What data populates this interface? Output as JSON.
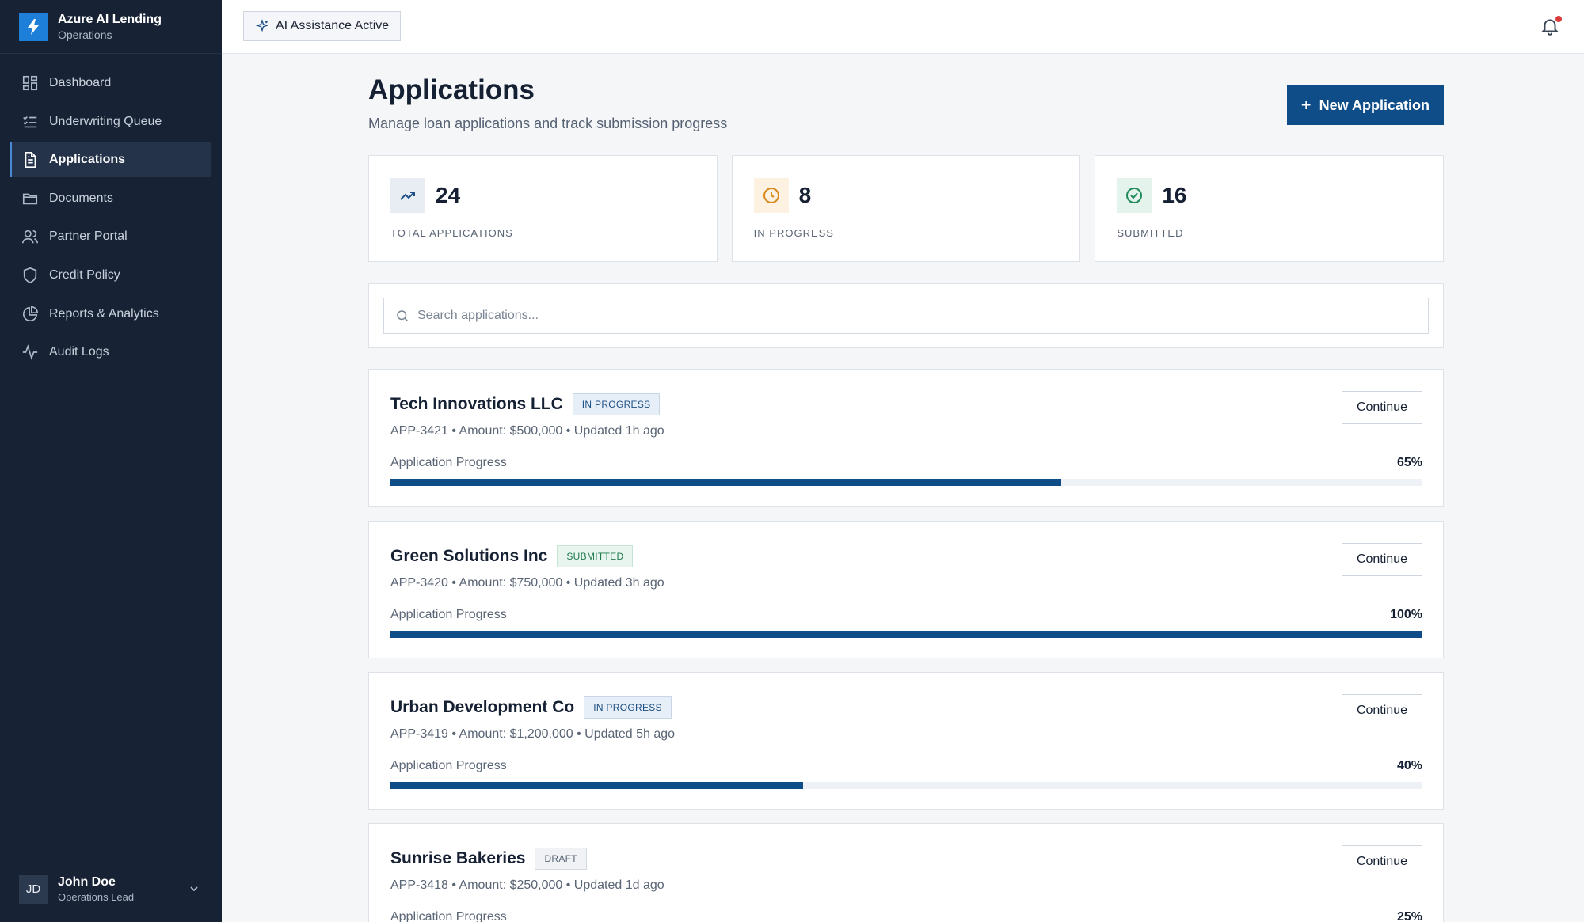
{
  "brand": {
    "title": "Azure AI Lending",
    "subtitle": "Operations"
  },
  "sidebar": {
    "items": [
      {
        "label": "Dashboard",
        "icon": "dashboard-icon",
        "active": false
      },
      {
        "label": "Underwriting Queue",
        "icon": "checklist-icon",
        "active": false
      },
      {
        "label": "Applications",
        "icon": "document-icon",
        "active": true
      },
      {
        "label": "Documents",
        "icon": "folder-icon",
        "active": false
      },
      {
        "label": "Partner Portal",
        "icon": "users-icon",
        "active": false
      },
      {
        "label": "Credit Policy",
        "icon": "shield-icon",
        "active": false
      },
      {
        "label": "Reports & Analytics",
        "icon": "pie-chart-icon",
        "active": false
      },
      {
        "label": "Audit Logs",
        "icon": "activity-icon",
        "active": false
      }
    ]
  },
  "user": {
    "initials": "JD",
    "name": "John Doe",
    "role": "Operations Lead"
  },
  "topbar": {
    "ai_badge": "AI Assistance Active",
    "notifications_unread": true
  },
  "page": {
    "title": "Applications",
    "subtitle": "Manage loan applications and track submission progress",
    "new_button": "New Application"
  },
  "stats": [
    {
      "value": "24",
      "label": "TOTAL APPLICATIONS",
      "icon": "trending-up-icon",
      "color": "#1e4f85",
      "bg": "#e8edf3"
    },
    {
      "value": "8",
      "label": "IN PROGRESS",
      "icon": "clock-icon",
      "color": "#d9891c",
      "bg": "#fdf1e1"
    },
    {
      "value": "16",
      "label": "SUBMITTED",
      "icon": "check-circle-icon",
      "color": "#1f8a5a",
      "bg": "#e4f4ec"
    }
  ],
  "search": {
    "placeholder": "Search applications..."
  },
  "applications": [
    {
      "name": "Tech Innovations LLC",
      "status": "IN PROGRESS",
      "status_type": "in-progress",
      "meta": "APP-3421 • Amount: $500,000 • Updated 1h ago",
      "progress_label": "Application Progress",
      "progress_text": "65%",
      "progress": 0.65,
      "action": "Continue"
    },
    {
      "name": "Green Solutions Inc",
      "status": "SUBMITTED",
      "status_type": "submitted",
      "meta": "APP-3420 • Amount: $750,000 • Updated 3h ago",
      "progress_label": "Application Progress",
      "progress_text": "100%",
      "progress": 1.0,
      "action": "Continue"
    },
    {
      "name": "Urban Development Co",
      "status": "IN PROGRESS",
      "status_type": "in-progress",
      "meta": "APP-3419 • Amount: $1,200,000 • Updated 5h ago",
      "progress_label": "Application Progress",
      "progress_text": "40%",
      "progress": 0.4,
      "action": "Continue"
    },
    {
      "name": "Sunrise Bakeries",
      "status": "DRAFT",
      "status_type": "draft",
      "meta": "APP-3418 • Amount: $250,000 • Updated 1d ago",
      "progress_label": "Application Progress",
      "progress_text": "25%",
      "progress": 0.25,
      "action": "Continue"
    }
  ]
}
